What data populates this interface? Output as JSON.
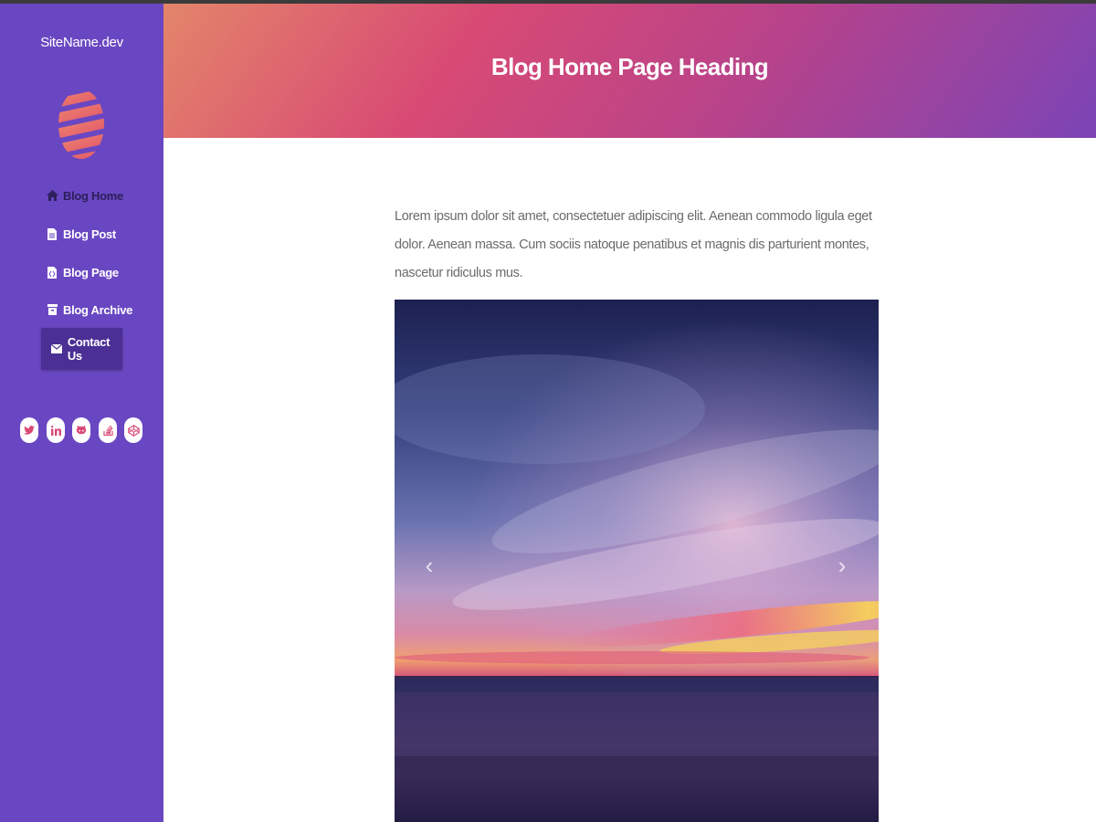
{
  "site": {
    "name": "SiteName.dev"
  },
  "sidebar": {
    "items": [
      {
        "label": "Blog Home",
        "icon": "home-icon"
      },
      {
        "label": "Blog Post",
        "icon": "file-icon"
      },
      {
        "label": "Blog Page",
        "icon": "file-code-icon"
      },
      {
        "label": "Blog Archive",
        "icon": "archive-icon"
      },
      {
        "label": "Contact Us",
        "icon": "envelope-icon"
      }
    ],
    "social": [
      "twitter-icon",
      "linkedin-icon",
      "github-icon",
      "stack-overflow-icon",
      "codepen-icon"
    ]
  },
  "header": {
    "title": "Blog Home Page Heading"
  },
  "main": {
    "intro": "Lorem ipsum dolor sit amet, consectetuer adipiscing elit. Aenean commodo ligula eget dolor. Aenean massa. Cum sociis natoque penatibus et magnis dis parturient montes, nascetur ridiculus mus.",
    "carousel": {
      "prev": "‹",
      "next": "›"
    }
  },
  "colors": {
    "sidebar": "#6a47c2",
    "nav_active_bg": "#4b2f95",
    "social_icon": "#d84a74",
    "header_gradient": [
      "#e3856a",
      "#d84a74",
      "#b8438a",
      "#7b44b6"
    ]
  }
}
